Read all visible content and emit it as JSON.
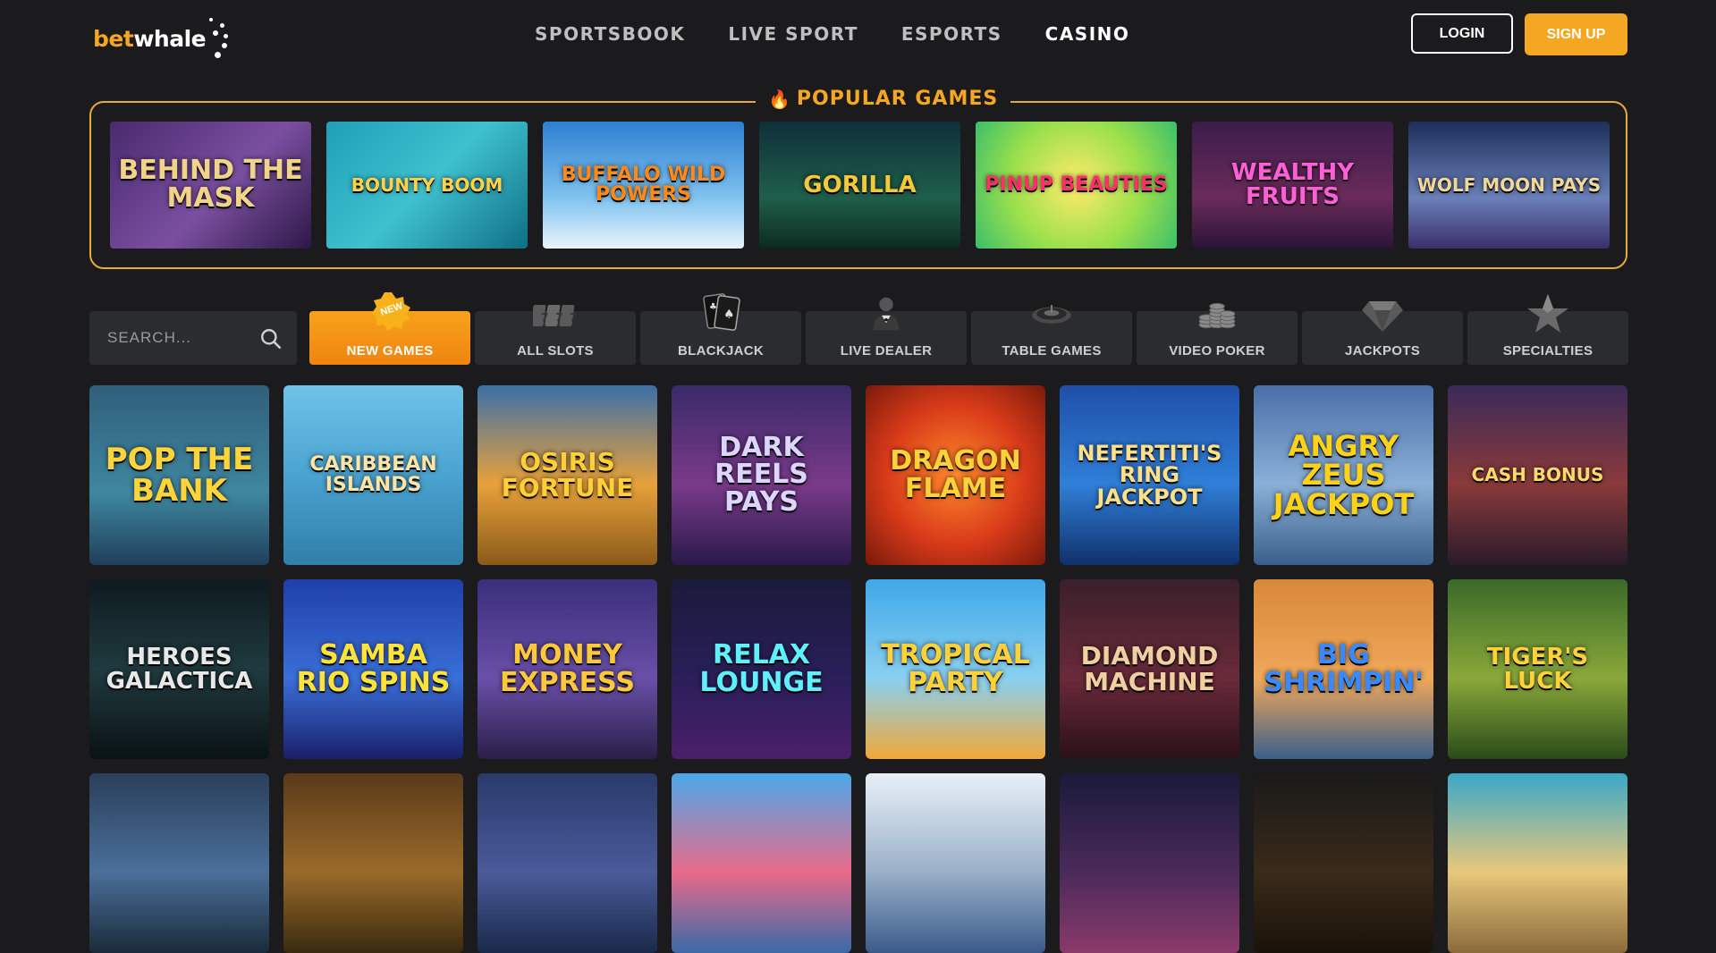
{
  "brand": {
    "part1": "bet",
    "part2": "whale",
    "accent": "#f5a623"
  },
  "nav": {
    "items": [
      {
        "label": "SPORTSBOOK",
        "active": false
      },
      {
        "label": "LIVE SPORT",
        "active": false
      },
      {
        "label": "ESPORTS",
        "active": false
      },
      {
        "label": "CASINO",
        "active": true
      }
    ]
  },
  "auth": {
    "login_label": "LOGIN",
    "signup_label": "SIGN UP"
  },
  "popular": {
    "title": "POPULAR GAMES",
    "games": [
      {
        "title": "Behind the Mask",
        "bg": "linear-gradient(135deg,#4a2a6e,#7a4fa0 55%,#2d1846)",
        "color": "#f1d38a",
        "size": 30
      },
      {
        "title": "Bounty Boom",
        "bg": "linear-gradient(135deg,#1f9fb8,#3fc1cf 50%,#0f6f85)",
        "color": "#ffd24a",
        "size": 20
      },
      {
        "title": "Buffalo Wild Powers",
        "bg": "linear-gradient(180deg,#2d7fd2,#7fc3f0 60%,#eaf4fb)",
        "color": "#ff8a1a",
        "size": 22
      },
      {
        "title": "Gorilla",
        "bg": "linear-gradient(180deg,#0f2f3a,#1f5f4a 60%,#0b2a20)",
        "color": "#f3c83a",
        "size": 26
      },
      {
        "title": "Pinup Beauties",
        "bg": "radial-gradient(circle,#ffeb6a,#9be04c 55%,#3bbf6a)",
        "color": "#ff2f6a",
        "size": 22
      },
      {
        "title": "Wealthy Fruits",
        "bg": "linear-gradient(180deg,#3b1d4a,#6a2b5a 60%,#2a1436)",
        "color": "#ff5fd6",
        "size": 26
      },
      {
        "title": "Wolf Moon Pays",
        "bg": "linear-gradient(180deg,#1d2f5a,#6a7fb8 60%,#3a2f6a)",
        "color": "#f0d89a",
        "size": 20
      }
    ]
  },
  "search": {
    "placeholder": "SEARCH..."
  },
  "categories": [
    {
      "label": "NEW GAMES",
      "icon": "new-badge-icon",
      "active": true,
      "badge": "NEW"
    },
    {
      "label": "ALL SLOTS",
      "icon": "slot-machine-icon",
      "active": false
    },
    {
      "label": "BLACKJACK",
      "icon": "playing-cards-icon",
      "active": false
    },
    {
      "label": "LIVE DEALER",
      "icon": "dealer-icon",
      "active": false
    },
    {
      "label": "TABLE GAMES",
      "icon": "roulette-wheel-icon",
      "active": false
    },
    {
      "label": "VIDEO POKER",
      "icon": "poker-chips-icon",
      "active": false
    },
    {
      "label": "JACKPOTS",
      "icon": "diamond-icon",
      "active": false
    },
    {
      "label": "SPECIALTIES",
      "icon": "star-icon",
      "active": false
    }
  ],
  "games": [
    {
      "title": "Pop the Bank",
      "bg": "linear-gradient(180deg,#2f5f7a,#3f87a0 60%,#1f3f5a)",
      "color": "#ffd43a",
      "size": 34
    },
    {
      "title": "Caribbean Islands",
      "bg": "linear-gradient(180deg,#6fc3e8,#4aa3d0 50%,#2f7fa8)",
      "color": "#ffe4a8",
      "size": 22
    },
    {
      "title": "Osiris Fortune",
      "bg": "linear-gradient(180deg,#3a6fa8,#e8a13a 55%,#8a5a1a)",
      "color": "#ffcf3a",
      "size": 28
    },
    {
      "title": "Dark Reels Pays",
      "bg": "linear-gradient(180deg,#3a2a6a,#7a3a8a 55%,#2a1a4a)",
      "color": "#dcd6ff",
      "size": 30
    },
    {
      "title": "Dragon Flame",
      "bg": "radial-gradient(circle,#ff8a2a,#d83a1a 55%,#7a1a0a)",
      "color": "#ffd23a",
      "size": 30
    },
    {
      "title": "Nefertiti's Ring Jackpot",
      "bg": "linear-gradient(180deg,#1f4fa8,#2f7fd8 55%,#10306a)",
      "color": "#ffe08a",
      "size": 24
    },
    {
      "title": "Angry Zeus Jackpot",
      "bg": "linear-gradient(180deg,#4a6fa8,#8ab0d8 55%,#3a5f8a)",
      "color": "#ffd21a",
      "size": 32
    },
    {
      "title": "Cash Bonus",
      "bg": "linear-gradient(180deg,#3a2a5a,#8a3a3a 55%,#2a1a2a)",
      "color": "#ffd86a",
      "size": 20
    },
    {
      "title": "Heroes Galactica",
      "bg": "linear-gradient(180deg,#0f1a1f,#1f3a3f 50%,#0a1214)",
      "color": "#e8e8e8",
      "size": 26
    },
    {
      "title": "Samba Rio Spins",
      "bg": "linear-gradient(180deg,#1f3fa8,#3a6fd8 55%,#1a1f6a)",
      "color": "#ffe23a",
      "size": 30
    },
    {
      "title": "Money Express",
      "bg": "linear-gradient(180deg,#3a2f7a,#6a4fa8 55%,#2a1f4a)",
      "color": "#ffc83a",
      "size": 30
    },
    {
      "title": "Relax Lounge",
      "bg": "linear-gradient(180deg,#1a1a3a,#2a1f5a 55%,#4a1f6a)",
      "color": "#5ff0ff",
      "size": 30
    },
    {
      "title": "Tropical Party",
      "bg": "linear-gradient(180deg,#3fa8e8,#8ad0f0 55%,#f0a83a)",
      "color": "#ffd23a",
      "size": 30
    },
    {
      "title": "Diamond Machine",
      "bg": "linear-gradient(180deg,#3a1f2a,#6a2a3a 55%,#2a1018)",
      "color": "#f0d0a0",
      "size": 28
    },
    {
      "title": "Big Shrimpin'",
      "bg": "linear-gradient(180deg,#d8883a,#f0a85a 55%,#3a5f8a)",
      "color": "#3a8aff",
      "size": 30
    },
    {
      "title": "Tiger's Luck",
      "bg": "linear-gradient(180deg,#3a6a2a,#8aa83a 55%,#2a4a1a)",
      "color": "#ffd23a",
      "size": 26
    },
    {
      "title": "",
      "bg": "linear-gradient(180deg,#2a3f5a,#4a6f9a 55%,#1a2a3a)",
      "color": "#ffd23a",
      "size": 20
    },
    {
      "title": "",
      "bg": "linear-gradient(180deg,#5a3a1a,#9a6a2a 55%,#3a2a10)",
      "color": "#ffd23a",
      "size": 20
    },
    {
      "title": "",
      "bg": "linear-gradient(180deg,#2a3a6a,#4a5a9a 55%,#1a2a4a)",
      "color": "#ffd23a",
      "size": 20
    },
    {
      "title": "",
      "bg": "linear-gradient(180deg,#4aa8e8,#e86a8a 55%,#3a6aa8)",
      "color": "#ffd23a",
      "size": 20
    },
    {
      "title": "",
      "bg": "linear-gradient(180deg,#e8f0f8,#9ab0c8 55%,#3a5a8a)",
      "color": "#ffd23a",
      "size": 20
    },
    {
      "title": "",
      "bg": "linear-gradient(180deg,#1a1a3a,#4a2a5a 55%,#8a3a6a)",
      "color": "#ffd23a",
      "size": 20
    },
    {
      "title": "",
      "bg": "linear-gradient(180deg,#1a1a1a,#3a2a1a 55%,#1a1208)",
      "color": "#ffd23a",
      "size": 20
    },
    {
      "title": "",
      "bg": "linear-gradient(180deg,#3aa8c8,#e8c87a 55%,#8a6a3a)",
      "color": "#ffd23a",
      "size": 20
    }
  ]
}
